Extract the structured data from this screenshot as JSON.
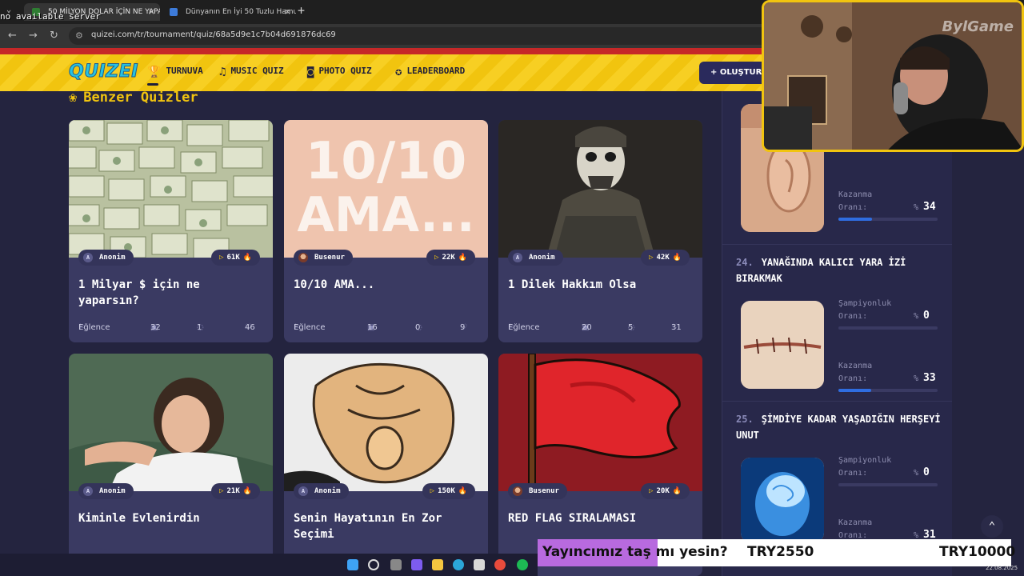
{
  "browser": {
    "tabs": [
      {
        "label": "50 MİLYON DOLAR İÇİN NE YAPAR"
      },
      {
        "label": "Dünyanın En İyi 50 Tuzlu Hamur İşi"
      }
    ],
    "overlay_text": "no available server",
    "url": "quizei.com/tr/tournament/quiz/68a5d9e1c7b04d691876dc69",
    "new_tab": "+",
    "tab_close": "×"
  },
  "header": {
    "logo": "QUIZEI",
    "nav": [
      {
        "label": "TURNUVA",
        "icon": "trophy-icon"
      },
      {
        "label": "MUSIC QUIZ",
        "icon": "music-note-icon"
      },
      {
        "label": "PHOTO QUIZ",
        "icon": "camera-icon"
      },
      {
        "label": "LEADERBOARD",
        "icon": "medal-icon"
      }
    ],
    "create_label": "+ OLUŞTUR"
  },
  "section": {
    "title": "Benzer Quizler"
  },
  "cards": [
    {
      "title": "1 Milyar $ için ne yaparsın?",
      "author": "Anonim",
      "author_initial": "A",
      "plays": "61K",
      "category": "Eğlence",
      "questions": "32",
      "comments": "1",
      "likes": "46"
    },
    {
      "title": "10/10 AMA...",
      "author": "Busenur",
      "author_initial": "",
      "plays": "22K",
      "category": "Eğlence",
      "questions": "16",
      "comments": "0",
      "likes": "9",
      "thumb_text_1": "10/10",
      "thumb_text_2": "AMA..."
    },
    {
      "title": "1 Dilek Hakkım Olsa",
      "author": "Anonim",
      "author_initial": "A",
      "plays": "42K",
      "category": "Eğlence",
      "questions": "20",
      "comments": "5",
      "likes": "31"
    },
    {
      "title": "Kiminle Evlenirdin",
      "author": "Anonim",
      "author_initial": "A",
      "plays": "21K"
    },
    {
      "title": "Senin Hayatının En Zor Seçimi",
      "author": "Anonim",
      "author_initial": "A",
      "plays": "150K"
    },
    {
      "title": "RED FLAG SIRALAMASI",
      "author": "Busenur",
      "author_initial": "",
      "plays": "20K"
    }
  ],
  "ranking": {
    "labels": {
      "champion_1": "Şampiyonluk",
      "champion_2": "Oranı:",
      "win_1": "Kazanma",
      "win_2": "Oranı:",
      "pct": "%"
    },
    "items": [
      {
        "number": "",
        "title": "",
        "champion": "",
        "win": "34",
        "win_fraction": 0.34
      },
      {
        "number": "24.",
        "title": "YANAĞINDA KALICI YARA İZİ BIRAKMAK",
        "champion": "0",
        "champion_fraction": 0,
        "win": "33",
        "win_fraction": 0.33
      },
      {
        "number": "25.",
        "title": "ŞİMDİYE KADAR YAŞADIĞIN HERŞEYİ UNUT",
        "champion": "0",
        "champion_fraction": 0,
        "win": "31",
        "win_fraction": 0.31
      }
    ]
  },
  "webcam": {
    "channel": "BylGame"
  },
  "ticker": {
    "question": "Yayıncımız taş mı yesin?",
    "option_a": "TRY2550",
    "option_b": "TRY10000"
  },
  "taskbar": {
    "date": "22.08.2025"
  },
  "colors": {
    "accent": "#f1c40f",
    "background": "#24243f",
    "card": "#3a3a62",
    "bar_fill": "#2f6de0",
    "header_red": "#c62828"
  }
}
